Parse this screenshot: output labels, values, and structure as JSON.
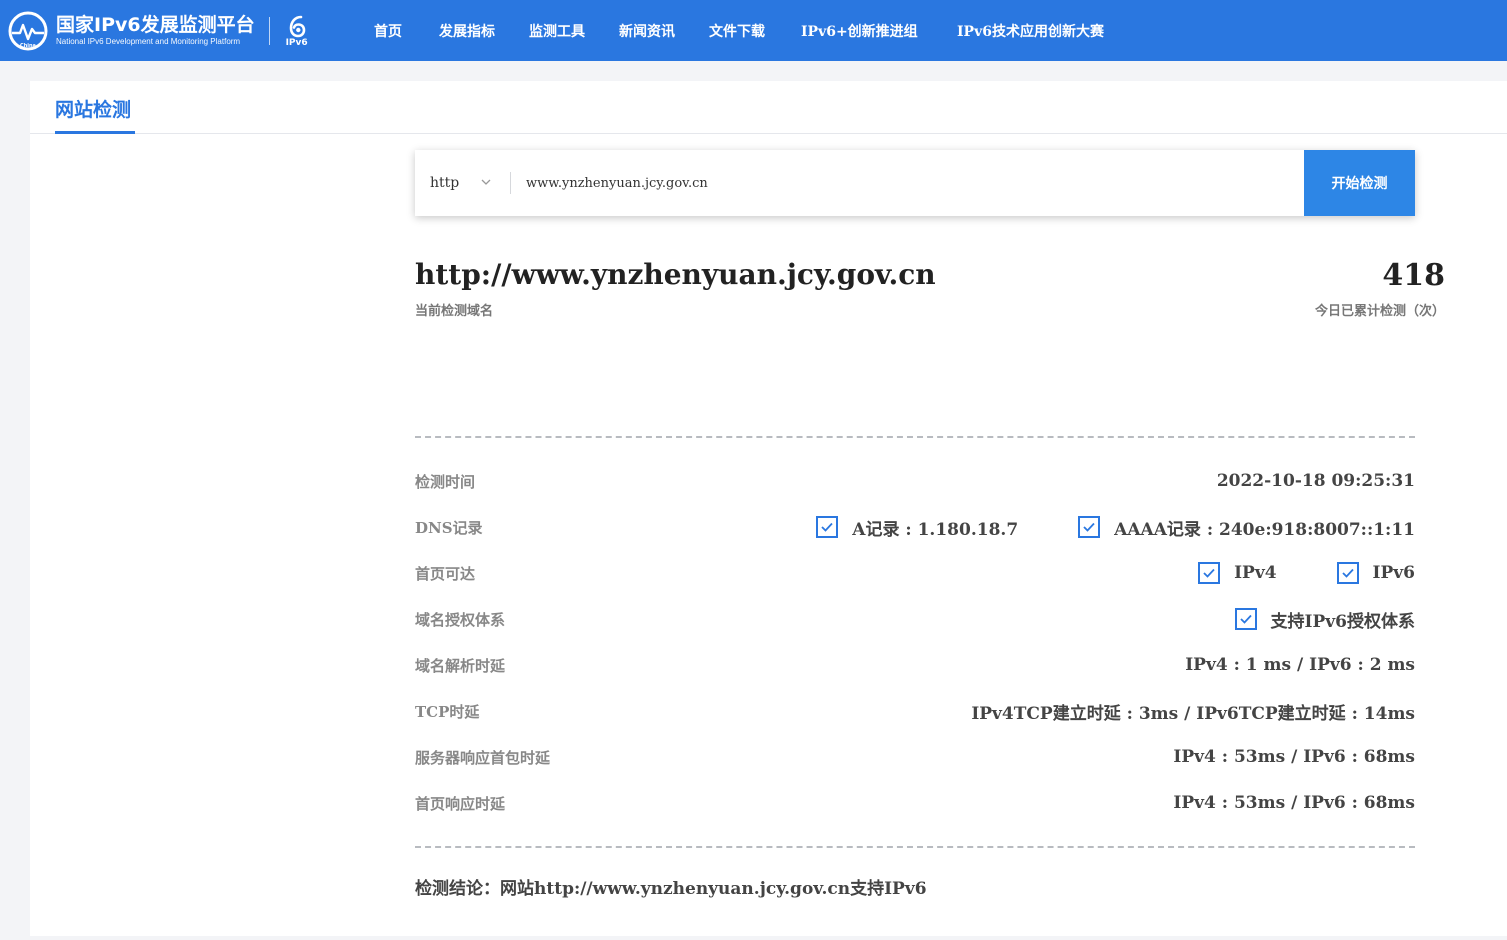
{
  "header": {
    "logo_title": "国家IPv6发展监测平台",
    "logo_subtitle": "National IPv6 Development and Monitoring Platform",
    "logo_badge": "China",
    "ipv6_label": "IPv6",
    "brand_color": "#2a77e0",
    "nav": [
      {
        "label": "首页"
      },
      {
        "label": "发展指标"
      },
      {
        "label": "监测工具"
      },
      {
        "label": "新闻资讯"
      },
      {
        "label": "文件下载"
      },
      {
        "label": "IPv6+创新推进组"
      },
      {
        "label": "IPv6技术应用创新大赛"
      }
    ]
  },
  "tab": {
    "label": "网站检测"
  },
  "search": {
    "protocol": "http",
    "url_value": "www.ynzhenyuan.jcy.gov.cn",
    "button_label": "开始检测"
  },
  "result": {
    "domain": "http://www.ynzhenyuan.jcy.gov.cn",
    "domain_caption": "当前检测域名",
    "count": "418",
    "count_caption": "今日已累计检测（次）",
    "rows": {
      "time": {
        "label": "检测时间",
        "value": "2022-10-18 09:25:31"
      },
      "dns": {
        "label": "DNS记录",
        "a_record": "A记录 : 1.180.18.7",
        "aaaa_record": "AAAA记录 : 240e:918:8007::1:11"
      },
      "reach": {
        "label": "首页可达",
        "ipv4": "IPv4",
        "ipv6": "IPv6"
      },
      "auth": {
        "label": "域名授权体系",
        "value": "支持IPv6授权体系"
      },
      "dns_delay": {
        "label": "域名解析时延",
        "value": "IPv4 : 1 ms / IPv6 : 2 ms"
      },
      "tcp": {
        "label": "TCP时延",
        "value": "IPv4TCP建立时延 : 3ms / IPv6TCP建立时延 : 14ms"
      },
      "server": {
        "label": "服务器响应首包时延",
        "value": "IPv4 : 53ms / IPv6 : 68ms"
      },
      "home": {
        "label": "首页响应时延",
        "value": "IPv4 : 53ms / IPv6 : 68ms"
      }
    },
    "conclusion": "检测结论：网站http://www.ynzhenyuan.jcy.gov.cn支持IPv6"
  }
}
